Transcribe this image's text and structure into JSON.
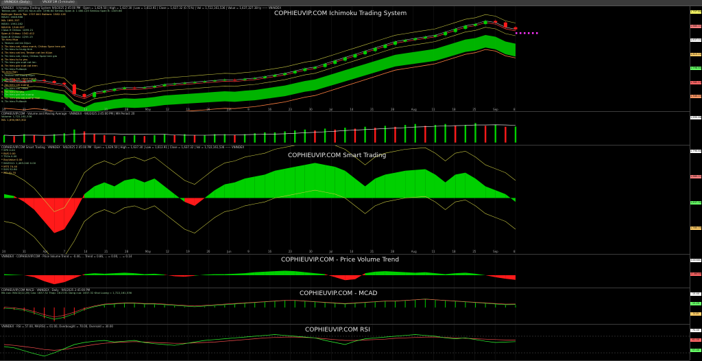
{
  "tabs": [
    {
      "label": "VNINDEX (Daily)"
    },
    {
      "label": "VN30F1M (5-minute)"
    }
  ],
  "panes": [
    {
      "id": "ichimoku",
      "watermark": "COPHIEUVIP.COM Ichimoku Trading System",
      "title": "VNINDEX · Ichimoku Trading System 9/6/2025 2:45:00 PM · Open = 1,629.50 | High = 1,637.30 | Low = 1,613.91 | Close = 1,637.32 (0.71%) | Vol = 1,722,161,536 | Value = 1,637,327.38 ty —— VNINDEX",
      "info": [
        "Tenkan-sen: 1637.01  Kijun-sen: 1598.64  Senkou Span A: 1 480.125  Senkou Span B: 1405.68",
        "Bollinger Bands Top: 1707.841  Bottom: 1582.126",
        "MA20: 1648.986",
        "MA: 1691.357",
        "MA50: 1592.282",
        "MA200: 1340.027",
        "Close-9 Chikou: 1495.21",
        "Span-A Chikou: 1342.412",
        "Span-B Chikou: 1255.13",
        "Tin hieu Mua",
        "1. Tenkan cat len Kijun",
        "2. Tin hieu cat, nhan manh, Chikou Span tren gia",
        "3. Tin hieu tu trung tinh",
        "4. Tin hieu cat len, Tenkan cat len Kijun",
        "5. Tin hieu cat, nhan, Chikou Span tren gia",
        "6. Tin hieu tu tu yeu",
        "7. Tin hieu gia vuot cat len",
        "8. Tin hieu gia vuot cat tren",
        "9. Tin hieu Pullback",
        "Tin hieu Ban",
        "1. Tenkan cat xuong Kijun",
        "2. Tin hieu cat, nhan manh",
        "3. Tin hieu tu trung tinh",
        "4. Tin hieu cat xuong",
        "5. Tin hieu cat, nhan",
        "6. Tin hieu tu yeu",
        "7. Tin hieu gia cat xuong",
        "8. Tin hieu gia cat xuong duoi",
        "9. Tin hieu Pullback"
      ],
      "ytags": [
        {
          "text": "1,707.84",
          "color": "#ffff66"
        },
        {
          "text": "1,680.01",
          "color": "#ff8080"
        },
        {
          "text": "1,637.01",
          "color": "#ffffff"
        },
        {
          "text": "1,615.22",
          "color": "#ffcc66"
        },
        {
          "text": "1,598.64",
          "color": "#66ff66"
        },
        {
          "text": "1,582.13",
          "color": "#ff6666"
        },
        {
          "text": "1,340.03",
          "color": "#ff9966"
        }
      ]
    },
    {
      "id": "volume",
      "watermark": "",
      "title": "COPHIEUVIP.COM · Volume and Moving Average · VNINDEX · 9/6/2025 2:45:00 PM | MA Period: 20",
      "info": [
        "Volume: 1,722,161,536",
        "MA: 1,690,663,302"
      ],
      "ytags": [
        {
          "text": "1,690.66",
          "color": "#ffffff"
        }
      ]
    },
    {
      "id": "smart",
      "watermark": "COPHIEUVIP.COM Smart Trading",
      "title": "COPHIEUVIP.COM Smart Trading · VNINDEX · 9/6/2025 2:45:00 PM · Open = 1,629.50 | High = 1,637.30 | Low = 1,613.91 | Close = 1,637.32 | Vol = 1,722,161,536 —— VNINDEX",
      "info": [
        "* SPS      0.00",
        "* BUS      0.00",
        "* TSOs     0.00",
        "* BuyValue    0.00",
        "* MAS510: 1,463.040   0.00",
        "* MTS      74.40",
        "* SGS      52.80",
        "* BTI      41.70"
      ],
      "ytags": [
        {
          "text": "1,790.60",
          "color": "#ffffff"
        },
        {
          "text": "1,680.01",
          "color": "#ff8080"
        },
        {
          "text": "1,637.32",
          "color": "#66ff66"
        },
        {
          "text": "1,580.00",
          "color": "#ffcc66"
        }
      ]
    },
    {
      "id": "pvt",
      "watermark": "COPHIEUVIP.COM - Price Volume Trend",
      "title": "VNINDEX · COPHIEUVIP.COM · Price Volume Trend = -0.46, ... Trend = 0.86, ... = 0.00, ... = 0.14",
      "info": [],
      "ytags": [
        {
          "text": "0.00000",
          "color": "#ffffff"
        },
        {
          "text": "-0.46000",
          "color": "#ff6666"
        }
      ]
    },
    {
      "id": "macd",
      "watermark": "COPHIEUVIP.COM - MCAD",
      "title": "COPHIEUVIP.COM MACD · VNINDEX · Daily · 9/6/2025 2:45:00 PM",
      "info": [
        "Ma cua: MACD(12,26) Cao: 1637.32  Thap: 1613.91  Dong cua: 1637.32  Khoi Luong = 1,722,161,536"
      ],
      "ytags": [
        {
          "text": "15.40",
          "color": "#ffffff"
        },
        {
          "text": "12.25",
          "color": "#66ff66"
        },
        {
          "text": "3.15",
          "color": "#ffcc66"
        }
      ]
    },
    {
      "id": "rsi",
      "watermark": "COPHIEUVIP.COM RSI",
      "title": "VNINDEX · RSI = 57.00, MA(RSI) = 61.00, Overbought = 70.00, Oversold = 30.00",
      "info": [],
      "ytags": [
        {
          "text": "70.00",
          "color": "#ffffff"
        },
        {
          "text": "61.00",
          "color": "#ff6666"
        },
        {
          "text": "57.00",
          "color": "#66ff66"
        }
      ]
    }
  ],
  "xaxis": {
    "ticks": [
      "24",
      "31",
      "Apr",
      "7",
      "14",
      "21",
      "28",
      "May",
      "12",
      "19",
      "26",
      "Jun",
      "9",
      "16",
      "23",
      "30",
      "Jul",
      "14",
      "21",
      "28",
      "Aug",
      "11",
      "18",
      "25",
      "Sep",
      "8"
    ]
  },
  "colors": {
    "bull": "#00d000",
    "bear": "#ff1a1a",
    "cloud_green": "#00c800",
    "cloud_red": "#e0a000",
    "kijun": "#ff4040",
    "tenkan": "#c0c0c0",
    "ma200": "#ff8040",
    "band": "#c8c840",
    "marker": "#ff33ff"
  },
  "chart_data": [
    {
      "type": "candlestick",
      "title": "COPHIEUVIP.COM Ichimoku Trading System",
      "series": [
        {
          "name": "VNINDEX",
          "values": [
            1320,
            1315,
            1310,
            1318,
            1312,
            1300,
            1290,
            1230,
            1210,
            1240,
            1250,
            1262,
            1270,
            1268,
            1272,
            1280,
            1290,
            1295,
            1300,
            1305,
            1310,
            1315,
            1320,
            1318,
            1325,
            1330,
            1340,
            1350,
            1360,
            1375,
            1390,
            1400,
            1420,
            1440,
            1460,
            1480,
            1500,
            1520,
            1540,
            1560,
            1570,
            1580,
            1590,
            1600,
            1620,
            1640,
            1660,
            1670,
            1690,
            1680,
            1650,
            1637
          ]
        }
      ]
    },
    {
      "type": "bar",
      "title": "Volume and Moving Average",
      "series": [
        {
          "name": "Volume",
          "values": [
            0.8,
            0.7,
            0.9,
            0.8,
            0.7,
            0.9,
            1.0,
            1.4,
            1.2,
            0.9,
            0.8,
            0.7,
            0.7,
            0.8,
            0.7,
            0.8,
            0.9,
            0.8,
            0.9,
            0.8,
            0.8,
            0.9,
            0.9,
            0.8,
            0.9,
            1.0,
            1.1,
            1.1,
            1.2,
            1.3,
            1.4,
            1.3,
            1.5,
            1.4,
            1.6,
            1.5,
            1.7,
            1.6,
            1.8,
            1.7,
            1.9,
            2.0,
            1.8,
            1.9,
            2.0,
            1.8,
            1.9,
            2.1,
            1.8,
            1.9,
            1.7,
            1.72
          ]
        }
      ]
    },
    {
      "type": "area",
      "title": "COPHIEUVIP.COM Smart Trading",
      "series": [
        {
          "name": "Smart",
          "values": [
            0.1,
            0.05,
            -0.1,
            -0.3,
            -0.6,
            -0.9,
            -0.8,
            -0.4,
            0.1,
            0.3,
            0.4,
            0.3,
            0.45,
            0.5,
            0.4,
            0.5,
            0.3,
            0.1,
            -0.1,
            -0.2,
            0.0,
            0.2,
            0.35,
            0.4,
            0.5,
            0.55,
            0.6,
            0.7,
            0.75,
            0.8,
            0.85,
            0.9,
            0.85,
            0.8,
            0.7,
            0.5,
            0.3,
            0.5,
            0.6,
            0.65,
            0.7,
            0.72,
            0.74,
            0.6,
            0.4,
            0.6,
            0.65,
            0.5,
            0.3,
            0.2,
            0.1,
            -0.1
          ]
        }
      ]
    },
    {
      "type": "area",
      "title": "COPHIEUVIP.COM - Price Volume Trend",
      "series": [
        {
          "name": "PVT",
          "values": [
            0.1,
            0.05,
            0.0,
            -0.2,
            -0.6,
            -0.9,
            -0.7,
            -0.3,
            0.1,
            0.2,
            0.15,
            0.2,
            0.25,
            0.2,
            0.1,
            0.15,
            0.05,
            -0.1,
            -0.15,
            -0.05,
            0.05,
            0.1,
            0.1,
            0.15,
            0.2,
            0.3,
            0.35,
            0.4,
            0.45,
            0.4,
            0.3,
            0.2,
            0.1,
            -0.2,
            -0.5,
            -0.4,
            0.2,
            0.35,
            0.4,
            0.35,
            0.3,
            0.25,
            0.3,
            0.2,
            0.1,
            0.2,
            0.25,
            0.15,
            0.0,
            -0.2,
            -0.35,
            -0.46
          ]
        }
      ]
    },
    {
      "type": "bar",
      "title": "COPHIEUVIP.COM - MCAD",
      "series": [
        {
          "name": "MACD Histogram",
          "values": [
            -2,
            -3,
            -5,
            -9,
            -14,
            -18,
            -15,
            -10,
            -4,
            0,
            3,
            4,
            5,
            5,
            4,
            4,
            3,
            2,
            1,
            0,
            1,
            2,
            3,
            4,
            5,
            6,
            7,
            8,
            9,
            9,
            8,
            7,
            6,
            5,
            4,
            5,
            6,
            7,
            8,
            8,
            9,
            10,
            11,
            10,
            9,
            8,
            7,
            6,
            5,
            4,
            3,
            3.15
          ]
        }
      ]
    },
    {
      "type": "line",
      "title": "COPHIEUVIP.COM RSI",
      "series": [
        {
          "name": "RSI",
          "values": [
            45,
            42,
            35,
            28,
            22,
            30,
            40,
            50,
            55,
            58,
            60,
            56,
            58,
            60,
            55,
            52,
            50,
            48,
            52,
            56,
            60,
            62,
            64,
            66,
            68,
            70,
            72,
            74,
            72,
            70,
            68,
            66,
            60,
            55,
            50,
            58,
            64,
            66,
            68,
            70,
            72,
            74,
            72,
            70,
            66,
            64,
            66,
            62,
            58,
            55,
            56,
            57
          ]
        },
        {
          "name": "MA(RSI)",
          "values": [
            50,
            48,
            45,
            42,
            38,
            36,
            38,
            42,
            46,
            50,
            53,
            55,
            56,
            57,
            56,
            55,
            54,
            53,
            53,
            54,
            55,
            56,
            58,
            60,
            62,
            64,
            66,
            67,
            68,
            68,
            67,
            66,
            64,
            62,
            60,
            60,
            61,
            62,
            63,
            65,
            66,
            67,
            68,
            68,
            67,
            66,
            65,
            64,
            63,
            62,
            61,
            61
          ]
        }
      ]
    }
  ]
}
